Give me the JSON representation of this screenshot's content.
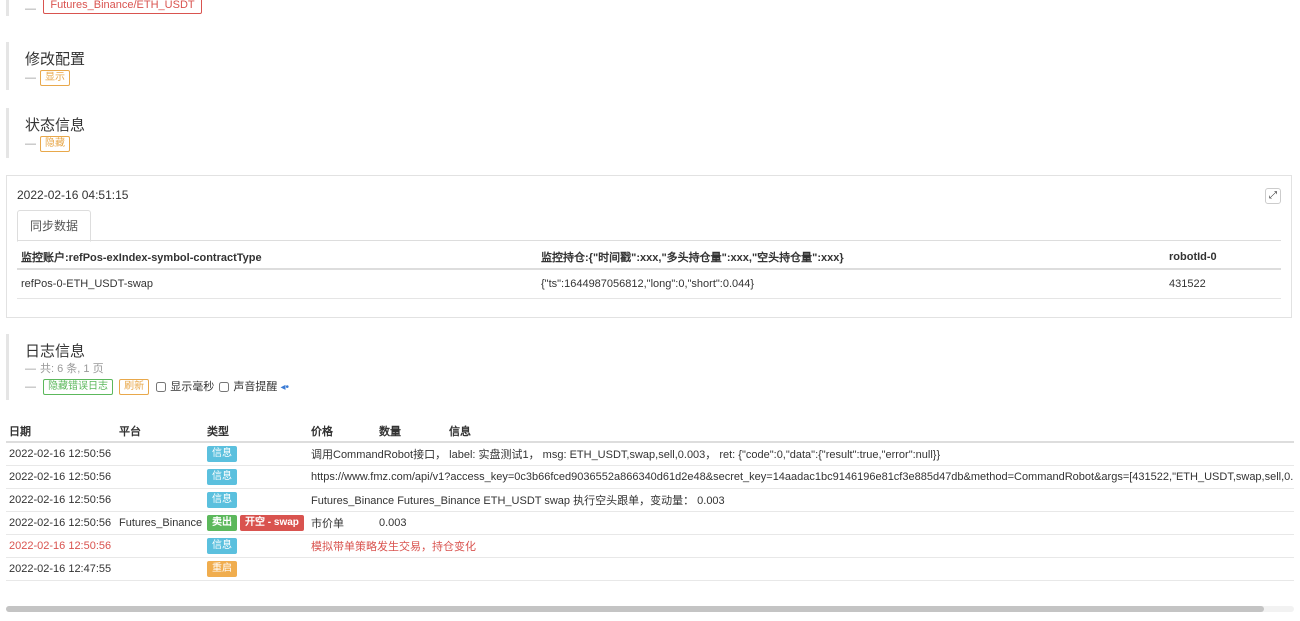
{
  "header": {
    "exchange_tag": "Futures_Binance/ETH_USDT"
  },
  "config_section": {
    "title": "修改配置",
    "toggle": "显示"
  },
  "status_section": {
    "title": "状态信息",
    "toggle": "隐藏"
  },
  "status_panel": {
    "timestamp": "2022-02-16 04:51:15",
    "tab": "同步数据",
    "columns": [
      "监控账户:refPos-exIndex-symbol-contractType",
      "监控持仓:{\"时间戳\":xxx,\"多头持仓量\":xxx,\"空头持仓量\":xxx}",
      "robotId-0"
    ],
    "rows": [
      [
        "refPos-0-ETH_USDT-swap",
        "{\"ts\":1644987056812,\"long\":0,\"short\":0.044}",
        "431522"
      ]
    ]
  },
  "log_section": {
    "title": "日志信息",
    "summary": "共: 6 条, 1 页",
    "hide_errors": "隐藏错误日志",
    "refresh": "刷新",
    "show_ms": "显示毫秒",
    "sound_alert": "声音提醒"
  },
  "log_table": {
    "columns": [
      "日期",
      "平台",
      "类型",
      "价格",
      "数量",
      "信息"
    ],
    "rows": [
      {
        "date": "2022-02-16 12:50:56",
        "platform": "",
        "types": [
          {
            "label": "信息",
            "kind": "info"
          }
        ],
        "price": "调用CommandRobot接口， label: 实盘测试1， msg: ETH_USDT,swap,sell,0.003， ret: {\"code\":0,\"data\":{\"result\":true,\"error\":null}}",
        "qty": "",
        "info": "",
        "span": true,
        "red": false
      },
      {
        "date": "2022-02-16 12:50:56",
        "platform": "",
        "types": [
          {
            "label": "信息",
            "kind": "info"
          }
        ],
        "price": "https://www.fmz.com/api/v1?access_key=0c3b66fced9036552a866340d61d2e48&secret_key=14aadac1bc9146196e81cf3e885d47db&method=CommandRobot&args=[431522,\"ETH_USDT,swap,sell,0.",
        "qty": "",
        "info": "",
        "span": true,
        "red": false
      },
      {
        "date": "2022-02-16 12:50:56",
        "platform": "",
        "types": [
          {
            "label": "信息",
            "kind": "info"
          }
        ],
        "price": "Futures_Binance Futures_Binance ETH_USDT swap 执行空头跟单，变动量： 0.003",
        "qty": "",
        "info": "",
        "span": true,
        "red": false
      },
      {
        "date": "2022-02-16 12:50:56",
        "platform": "Futures_Binance",
        "types": [
          {
            "label": "卖出",
            "kind": "sell"
          },
          {
            "label": "开空 - swap",
            "kind": "open"
          }
        ],
        "price": "市价单",
        "qty": "0.003",
        "info": "",
        "span": false,
        "red": false
      },
      {
        "date": "2022-02-16 12:50:56",
        "platform": "",
        "types": [
          {
            "label": "信息",
            "kind": "info"
          }
        ],
        "price": "模拟带单策略发生交易，持仓变化",
        "qty": "",
        "info": "",
        "span": true,
        "red": true
      },
      {
        "date": "2022-02-16 12:47:55",
        "platform": "",
        "types": [
          {
            "label": "重启",
            "kind": "restart"
          }
        ],
        "price": "",
        "qty": "",
        "info": "",
        "span": true,
        "red": false
      }
    ]
  },
  "colors": {
    "info": "#5bc0de",
    "sell": "#5cb85c",
    "open": "#d9534f",
    "restart": "#f0ad4e",
    "error_text": "#d9534f"
  }
}
